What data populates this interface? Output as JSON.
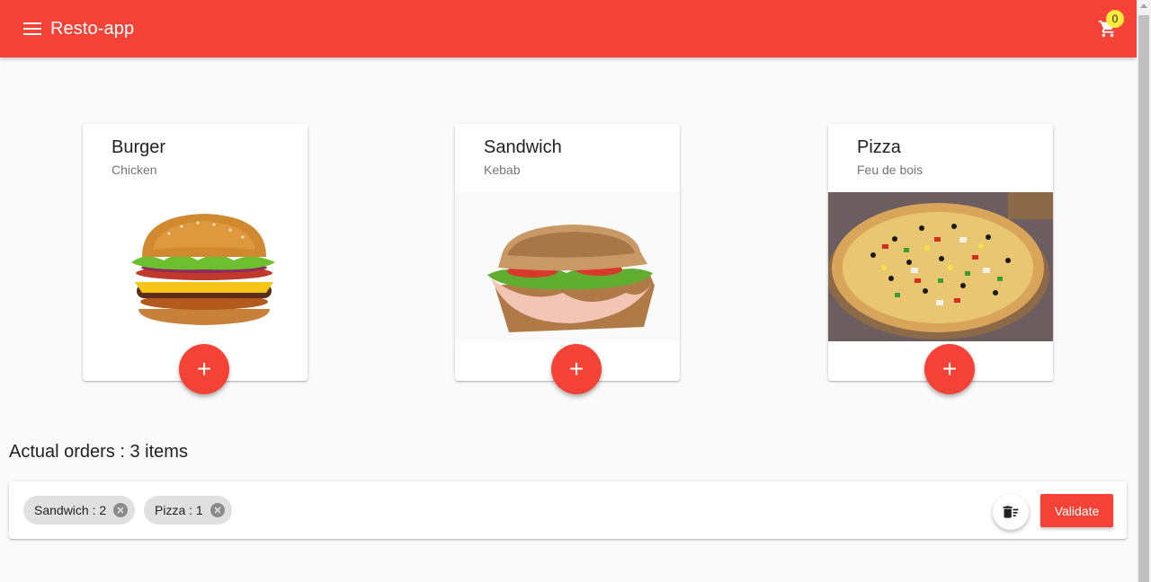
{
  "appbar": {
    "title": "Resto-app",
    "menu_icon": "hamburger-menu-icon",
    "cart_icon": "shopping-cart-icon",
    "cart_count": "0",
    "color": "#f44336"
  },
  "products": [
    {
      "title": "Burger",
      "subtitle": "Chicken",
      "add_label": "+"
    },
    {
      "title": "Sandwich",
      "subtitle": "Kebab",
      "add_label": "+"
    },
    {
      "title": "Pizza",
      "subtitle": "Feu de bois",
      "add_label": "+"
    }
  ],
  "orders": {
    "heading": "Actual orders : 3 items",
    "chips": [
      {
        "label": "Sandwich : 2"
      },
      {
        "label": "Pizza : 1"
      }
    ],
    "clear_icon": "delete-sweep-icon",
    "validate_label": "Validate"
  },
  "colors": {
    "accent": "#f44336",
    "badge": "#ffeb3b",
    "background": "#fafafa"
  }
}
